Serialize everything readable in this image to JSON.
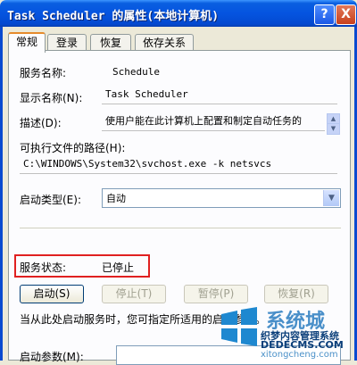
{
  "window": {
    "title": "Task Scheduler 的属性(本地计算机)",
    "help_label": "?",
    "close_label": "X"
  },
  "tabs": [
    {
      "label": "常规",
      "active": true
    },
    {
      "label": "登录",
      "active": false
    },
    {
      "label": "恢复",
      "active": false
    },
    {
      "label": "依存关系",
      "active": false
    }
  ],
  "general": {
    "service_name_label": "服务名称:",
    "service_name_value": "Schedule",
    "display_name_label": "显示名称(N):",
    "display_name_value": "Task Scheduler",
    "description_label": "描述(D):",
    "description_value": "使用户能在此计算机上配置和制定自动任务的",
    "exe_path_label": "可执行文件的路径(H):",
    "exe_path_value": "C:\\WINDOWS\\System32\\svchost.exe -k netsvcs",
    "startup_type_label": "启动类型(E):",
    "startup_type_value": "自动",
    "status_label": "服务状态:",
    "status_value": "已停止",
    "buttons": {
      "start": "启动(S)",
      "stop": "停止(T)",
      "pause": "暂停(P)",
      "resume": "恢复(R)"
    },
    "hint": "当从此处启动服务时，您可指定所适用的启动参数。",
    "start_params_label": "启动参数(M):",
    "start_params_value": ""
  },
  "watermark": {
    "line1": "系统城",
    "line2": "织梦内容管理系统",
    "line3": "DEDECMS.COM",
    "line4": "xitongcheng.com"
  }
}
